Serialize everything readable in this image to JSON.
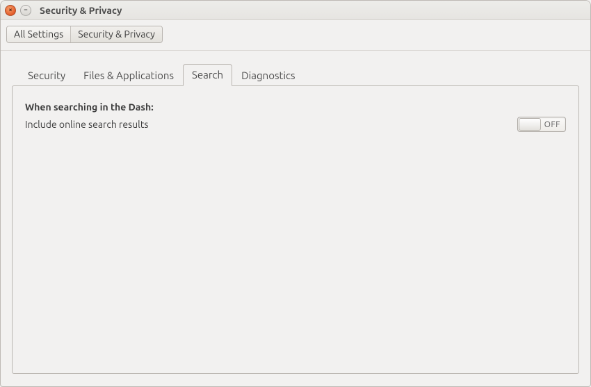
{
  "window": {
    "title": "Security & Privacy"
  },
  "breadcrumb": {
    "all_settings": "All Settings",
    "current": "Security & Privacy"
  },
  "tabs": {
    "security": "Security",
    "files": "Files & Applications",
    "search": "Search",
    "diagnostics": "Diagnostics"
  },
  "search_panel": {
    "heading": "When searching in the Dash:",
    "include_online": "Include online search results",
    "toggle_state": "OFF"
  }
}
